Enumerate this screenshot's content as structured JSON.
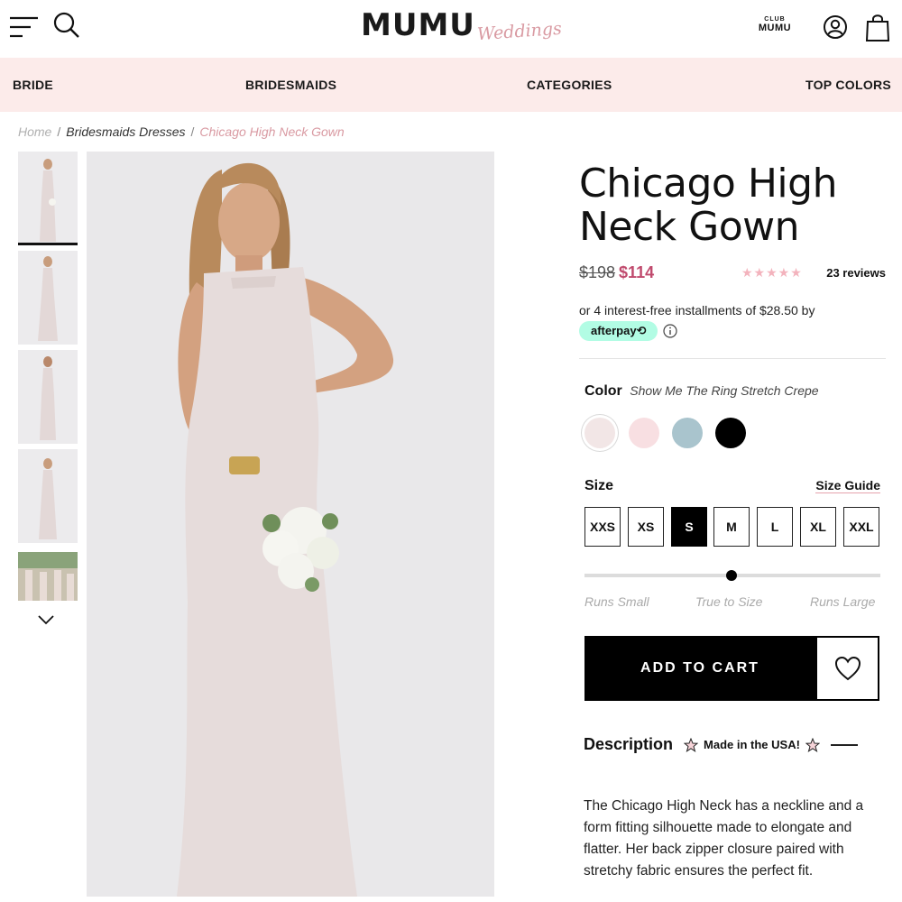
{
  "header": {
    "logo_main": "MUMU",
    "logo_script": "Weddings",
    "club_top": "CLUB",
    "club_bottom": "MUMU"
  },
  "nav": {
    "items": [
      "BRIDE",
      "BRIDESMAIDS",
      "CATEGORIES",
      "TOP COLORS"
    ]
  },
  "breadcrumb": {
    "home": "Home",
    "separator": "/",
    "parent": "Bridesmaids Dresses",
    "current": "Chicago High Neck Gown"
  },
  "product": {
    "title_line1": "Chicago High",
    "title_line2": "Neck Gown",
    "old_price": "$198",
    "new_price": "$114",
    "stars": "★★★★★",
    "reviews": "23 reviews",
    "installments": "or 4 interest-free installments of $28.50 by",
    "afterpay": "afterpay⟲",
    "color_label": "Color",
    "color_name": "Show Me The Ring Stretch Crepe",
    "swatches": [
      "#f2e6e6",
      "#f8dfe2",
      "#a9c4cd",
      "#000000"
    ],
    "selected_swatch": 0,
    "size_label": "Size",
    "size_guide": "Size Guide",
    "sizes": [
      "XXS",
      "XS",
      "S",
      "M",
      "L",
      "XL",
      "XXL"
    ],
    "selected_size": "S",
    "fit_labels": [
      "Runs Small",
      "True to Size",
      "Runs Large"
    ],
    "fit_value": "True to Size",
    "add_to_cart": "ADD TO CART",
    "description_label": "Description",
    "made_in": "Made in the USA!",
    "description": "The Chicago High Neck has a neckline and a form fitting silhouette made to elongate and flatter. Her back zipper closure paired with stretchy fabric ensures the perfect fit."
  },
  "colors": {
    "nav_bg": "#fcebea",
    "accent_pink": "#d99aa2",
    "sale_price": "#c04a6d",
    "afterpay_mint": "#b2fce4",
    "dress": "#e6dcdb"
  },
  "icons": [
    "menu-icon",
    "search-icon",
    "account-icon",
    "bag-icon",
    "chevron-down-icon",
    "info-icon",
    "heart-icon",
    "star-outline-icon"
  ]
}
